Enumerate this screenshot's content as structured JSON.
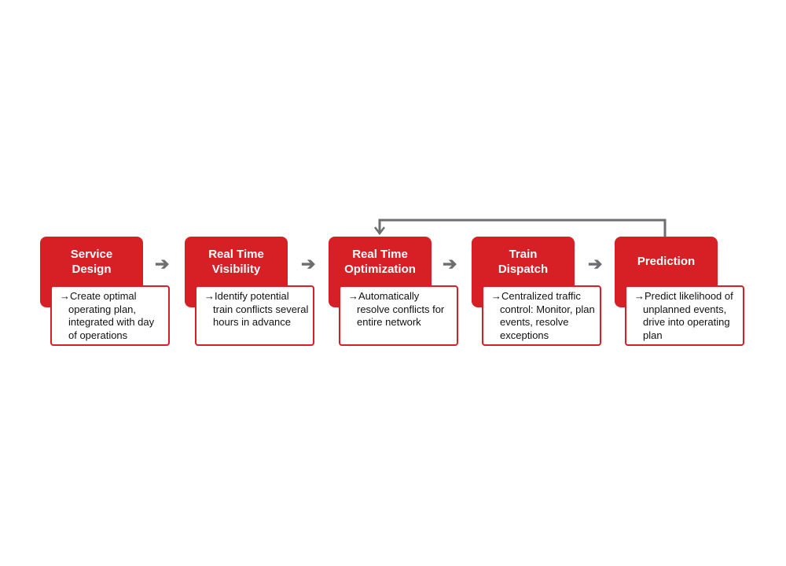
{
  "diagram": {
    "colors": {
      "step_fill": "#d71f26",
      "step_text": "#ffffff",
      "desc_border": "#d71f26",
      "desc_text": "#111111",
      "connector": "#6d6e71"
    },
    "bullet_glyph": "→",
    "connector_glyph": "➔",
    "steps": [
      {
        "title_line1": "Service",
        "title_line2": "Design",
        "description": "Create optimal operating plan, integrated with day of operations"
      },
      {
        "title_line1": "Real Time",
        "title_line2": "Visibility",
        "description": "Identify potential train conflicts several hours in advance"
      },
      {
        "title_line1": "Real Time",
        "title_line2": "Optimization",
        "description": "Automatically resolve conflicts for entire network"
      },
      {
        "title_line1": "Train",
        "title_line2": "Dispatch",
        "description": "Centralized traffic control: Monitor, plan events, resolve exceptions"
      },
      {
        "title_line1": "Prediction",
        "title_line2": "",
        "description": "Predict likelihood of unplanned events, drive into operating plan"
      }
    ],
    "feedback_loop": {
      "from": "Prediction",
      "to": "Real Time Optimization"
    }
  }
}
